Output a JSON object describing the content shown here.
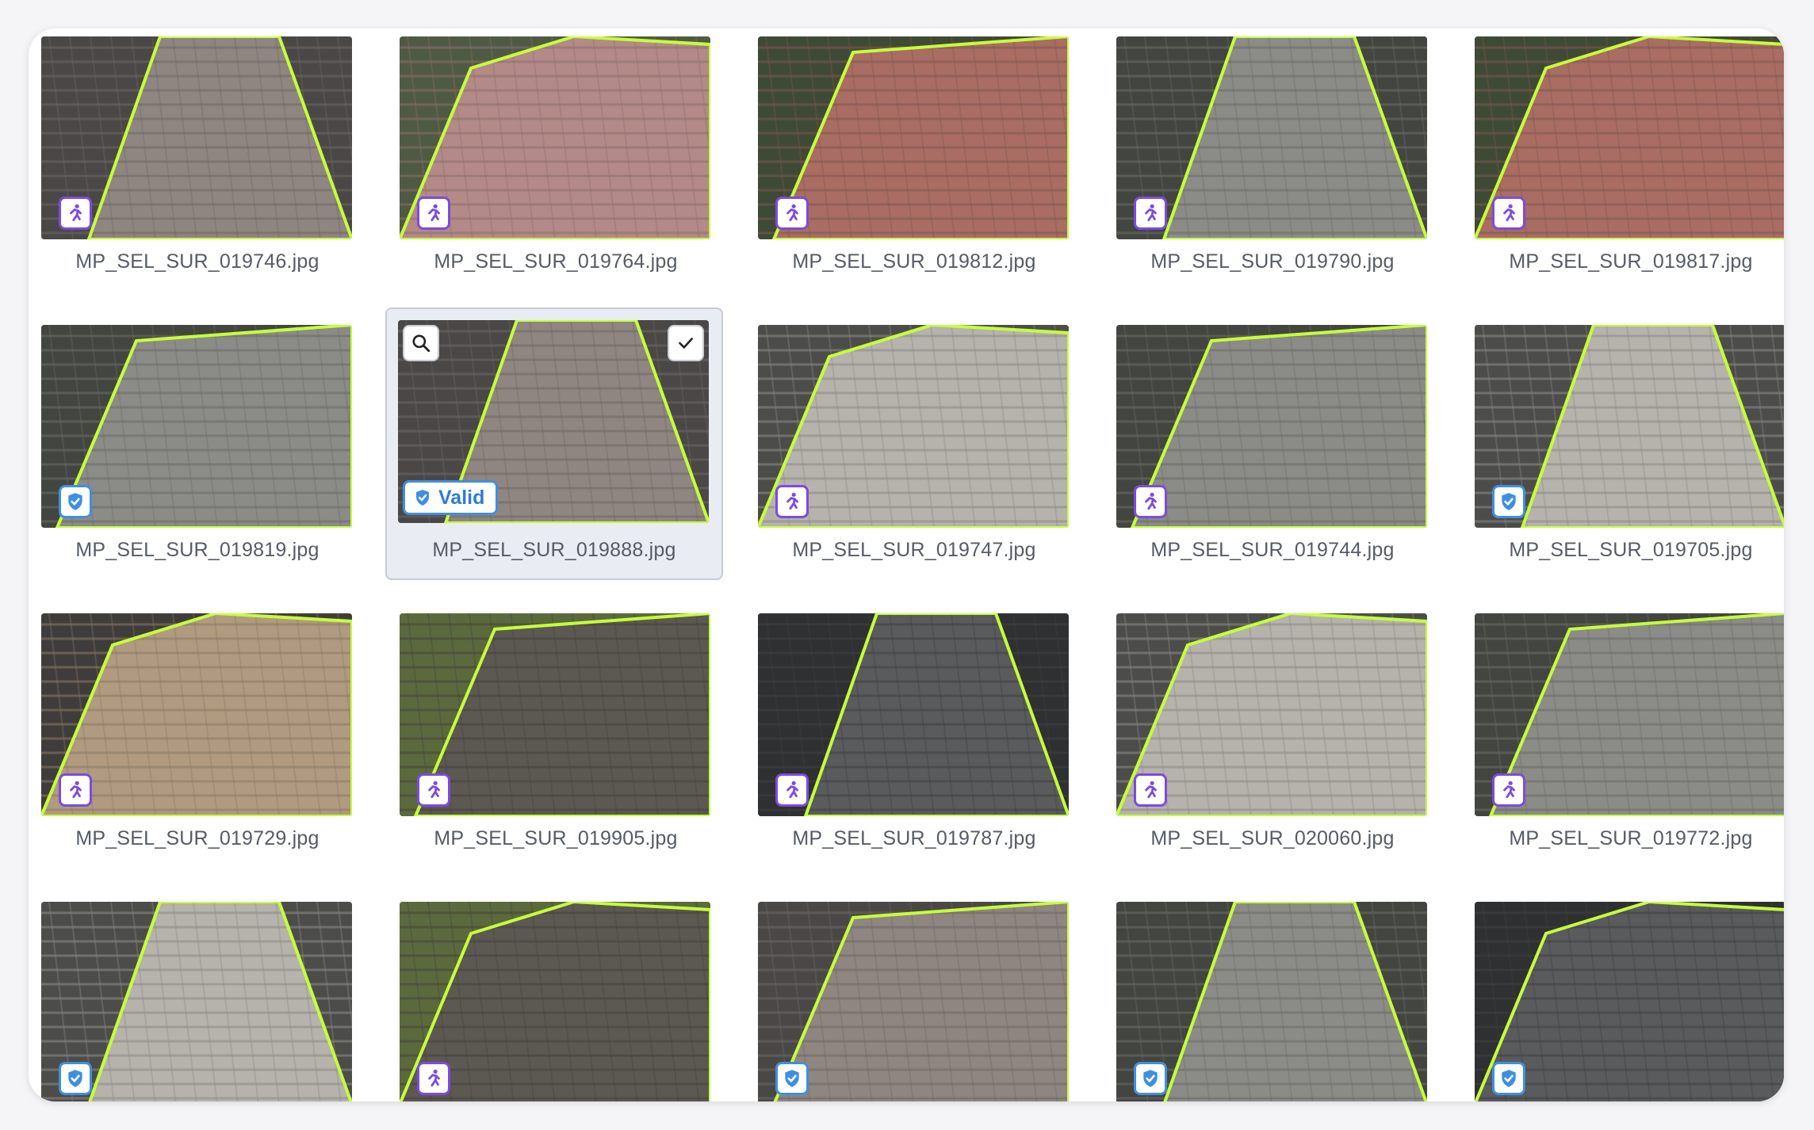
{
  "colors": {
    "accent_green": "#c6ff3a",
    "accent_purple": "#7b4be0",
    "valid_blue": "#3f8fe0"
  },
  "icons": {
    "pedestrian": "pedestrian-icon",
    "valid": "shield-check-icon",
    "zoom": "magnifier-icon",
    "check": "checkmark-icon"
  },
  "gallery": {
    "items": [
      {
        "filename": "MP_SEL_SUR_019746.jpg",
        "badge": "pedestrian",
        "scene": "pinkish"
      },
      {
        "filename": "MP_SEL_SUR_019764.jpg",
        "badge": "pedestrian",
        "scene": "pink"
      },
      {
        "filename": "MP_SEL_SUR_019812.jpg",
        "badge": "pedestrian",
        "scene": "red"
      },
      {
        "filename": "MP_SEL_SUR_019790.jpg",
        "badge": "pedestrian",
        "scene": "gray"
      },
      {
        "filename": "MP_SEL_SUR_019817.jpg",
        "badge": "pedestrian",
        "scene": "red"
      },
      {
        "filename": "MP_SEL_SUR_019819.jpg",
        "badge": "valid",
        "scene": "gray"
      },
      {
        "filename": "MP_SEL_SUR_019888.jpg",
        "badge": "valid",
        "scene": "pinkish",
        "selected": true,
        "label": "Valid"
      },
      {
        "filename": "MP_SEL_SUR_019747.jpg",
        "badge": "pedestrian",
        "scene": "light"
      },
      {
        "filename": "MP_SEL_SUR_019744.jpg",
        "badge": "pedestrian",
        "scene": "gray"
      },
      {
        "filename": "MP_SEL_SUR_019705.jpg",
        "badge": "valid",
        "scene": "light"
      },
      {
        "filename": "MP_SEL_SUR_019729.jpg",
        "badge": "pedestrian",
        "scene": "tan"
      },
      {
        "filename": "MP_SEL_SUR_019905.jpg",
        "badge": "pedestrian",
        "scene": "dark"
      },
      {
        "filename": "MP_SEL_SUR_019787.jpg",
        "badge": "pedestrian",
        "scene": "asphalt"
      },
      {
        "filename": "MP_SEL_SUR_020060.jpg",
        "badge": "pedestrian",
        "scene": "light"
      },
      {
        "filename": "MP_SEL_SUR_019772.jpg",
        "badge": "pedestrian",
        "scene": "gray"
      },
      {
        "filename": "",
        "badge": "valid",
        "scene": "light"
      },
      {
        "filename": "",
        "badge": "pedestrian",
        "scene": "dark"
      },
      {
        "filename": "",
        "badge": "valid",
        "scene": "pinkish"
      },
      {
        "filename": "",
        "badge": "valid",
        "scene": "gray"
      },
      {
        "filename": "",
        "badge": "valid",
        "scene": "asphalt"
      }
    ]
  }
}
